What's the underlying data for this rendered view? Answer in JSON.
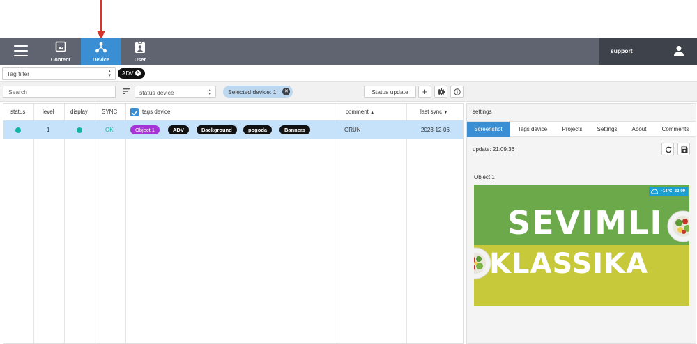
{
  "nav": {
    "items": [
      {
        "label": "Content",
        "icon": "image-icon"
      },
      {
        "label": "Device",
        "icon": "device-network-icon",
        "active": true
      },
      {
        "label": "User",
        "icon": "user-badge-icon"
      }
    ],
    "account": "support"
  },
  "tag_filter": {
    "placeholder": "Tag filter",
    "active_chip": "ADV"
  },
  "toolbar": {
    "search_placeholder": "Search",
    "status_select": "status device",
    "selected_chip": "Selected device: 1",
    "status_update": "Status update"
  },
  "table": {
    "headers": {
      "status": "status",
      "level": "level",
      "display": "display",
      "sync": "SYNC",
      "tags": "tags device",
      "comment": "comment",
      "last_sync": "last sync"
    },
    "rows": [
      {
        "level": "1",
        "sync": "OK",
        "tags": [
          "Object 1",
          "ADV",
          "Background",
          "pogoda",
          "Banners"
        ],
        "comment": "GRUN",
        "last_sync": "2023-12-06"
      }
    ]
  },
  "panel": {
    "title": "settings",
    "tabs": [
      "Screenshot",
      "Tags device",
      "Projects",
      "Settings",
      "About",
      "Comments"
    ],
    "active_tab": "Screenshot",
    "update_text": "update: 21:09:36",
    "object_title": "Object 1",
    "screenshot": {
      "word_top": "SEVIMLI",
      "word_bottom": "KLASSIKA",
      "temp": "-14°C",
      "time": "22:09"
    }
  },
  "colors": {
    "nav_bg": "#5f6470",
    "accent": "#3a8fd4",
    "status_dot": "#12b5a3",
    "row_selected": "#c6e2fb",
    "tag_purple": "#a533d6",
    "annotation_arrow": "#d9342b"
  }
}
